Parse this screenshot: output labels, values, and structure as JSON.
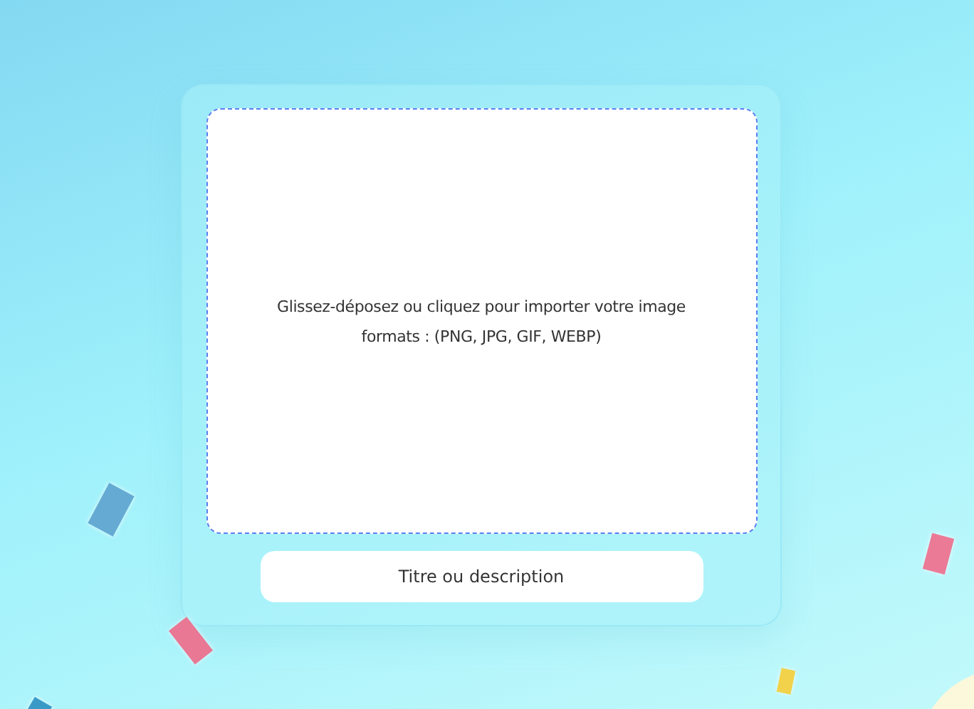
{
  "dropzone": {
    "lines": [
      "Glissez-déposez ou cliquez pour importer votre image",
      "formats : (PNG, JPG, GIF, WEBP)"
    ]
  },
  "title_field": {
    "placeholder": "Titre ou description"
  }
}
